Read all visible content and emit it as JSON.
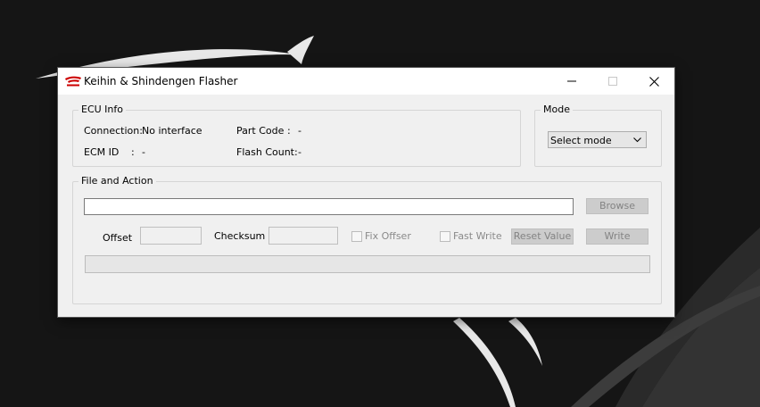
{
  "window": {
    "title": "Keihin & Shindengen Flasher",
    "app_icon": "honda-wing-logo-icon",
    "controls": [
      "minimize-icon",
      "maximize-icon",
      "close-icon"
    ]
  },
  "ecu_info": {
    "title": "ECU Info",
    "connection_label": "Connection:",
    "connection_value": "No interface",
    "ecm_id_label": "ECM ID",
    "ecm_id_sep": ":",
    "ecm_id_value": "-",
    "part_code_label": "Part Code",
    "part_code_sep": ":",
    "part_code_value": "-",
    "flash_count_label": "Flash Count:",
    "flash_count_value": "-"
  },
  "mode": {
    "title": "Mode",
    "selected": "Select mode"
  },
  "file_action": {
    "title": "File and Action",
    "file_path": "",
    "browse_label": "Browse",
    "offset_label": "Offset",
    "offset_value": "",
    "checksum_label": "Checksum",
    "checksum_value": "",
    "fix_offset_label": "Fix Offser",
    "fix_offset_checked": false,
    "fast_write_label": "Fast Write",
    "fast_write_checked": false,
    "reset_value_label": "Reset Value",
    "write_label": "Write",
    "progress": 0
  },
  "colors": {
    "desktop_bg": "#151515",
    "window_bg": "#f0f0f0",
    "titlebar_bg": "#ffffff",
    "disabled_button_bg": "#cccccc",
    "disabled_text": "#838383",
    "honda_red": "#cc0000"
  }
}
